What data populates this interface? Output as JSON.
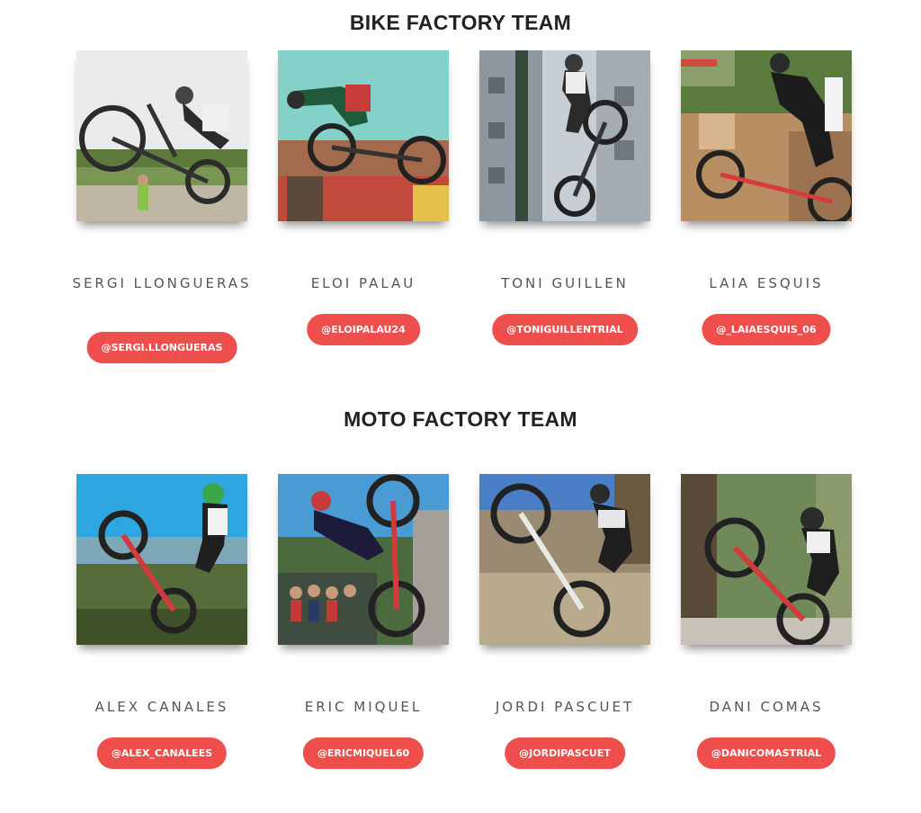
{
  "bike_team": {
    "title": "BIKE FACTORY TEAM",
    "members": [
      {
        "name": "SERGI LLONGUERAS",
        "handle": "@SERGI.LLONGUERAS",
        "photo": "rider-on-bike-photo"
      },
      {
        "name": "ELOI PALAU",
        "handle": "@ELOIPALAU24",
        "photo": "rider-on-bike-photo"
      },
      {
        "name": "TONI GUILLEN",
        "handle": "@TONIGUILLENTRIAL",
        "photo": "rider-on-bike-photo"
      },
      {
        "name": "LAIA ESQUIS",
        "handle": "@_LAIAESQUIS_06",
        "photo": "rider-on-bike-photo"
      }
    ]
  },
  "moto_team": {
    "title": "MOTO FACTORY TEAM",
    "members": [
      {
        "name": "ALEX CANALES",
        "handle": "@ALEX_CANALEES",
        "photo": "rider-on-motorbike-photo"
      },
      {
        "name": "ERIC MIQUEL",
        "handle": "@ERICMIQUEL60",
        "photo": "rider-on-motorbike-photo"
      },
      {
        "name": "JORDI PASCUET",
        "handle": "@JORDIPASCUET",
        "photo": "rider-on-motorbike-photo"
      },
      {
        "name": "DANI COMAS",
        "handle": "@DANICOMASTRIAL",
        "photo": "rider-on-motorbike-photo"
      }
    ]
  },
  "colors": {
    "accent": "#ef4f4c",
    "title_text": "#222222",
    "name_text": "#555555"
  }
}
